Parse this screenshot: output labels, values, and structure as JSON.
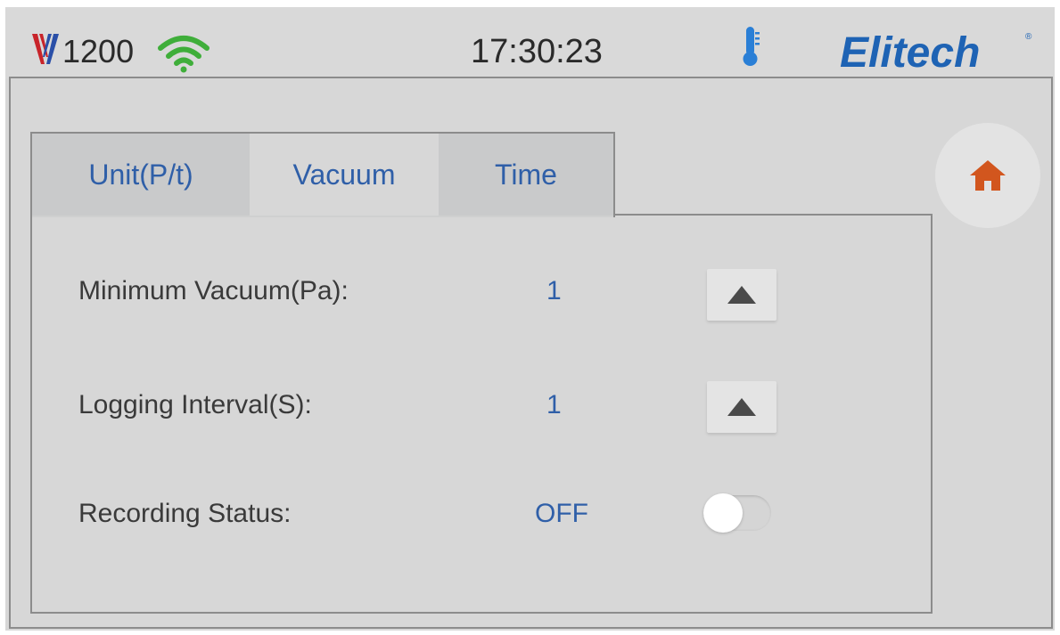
{
  "status_bar": {
    "model": "1200",
    "time": "17:30:23",
    "brand": "Elitech",
    "brand_mark": "®",
    "icons": {
      "device_logo": "v-logo-icon",
      "wifi": "wifi-icon",
      "thermometer": "thermometer-icon"
    },
    "colors": {
      "wifi": "#3fae3a",
      "brand": "#1e63b4",
      "thermometer": "#2a7fd6",
      "logo_red": "#c8242a",
      "logo_blue": "#2a4fa8"
    }
  },
  "tabs": [
    {
      "label": "Unit(P/t)",
      "active": false
    },
    {
      "label": "Vacuum",
      "active": true
    },
    {
      "label": "Time",
      "active": false
    }
  ],
  "settings": {
    "minimum_vacuum": {
      "label": "Minimum Vacuum(Pa):",
      "value": "1"
    },
    "logging_interval": {
      "label": "Logging Interval(S):",
      "value": "1"
    },
    "recording_status": {
      "label": "Recording Status:",
      "value": "OFF",
      "toggle_on": false
    }
  },
  "home": {
    "icon": "home-icon",
    "color": "#d2561e"
  }
}
